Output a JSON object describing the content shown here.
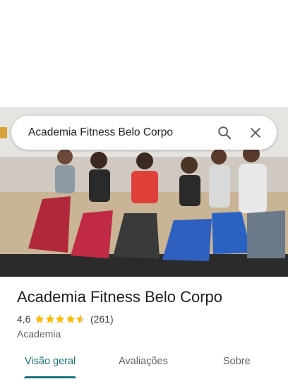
{
  "search": {
    "query": "Academia Fitness Belo Corpo"
  },
  "icons": {
    "search": "search-icon",
    "close": "close-icon",
    "star": "star-icon"
  },
  "place": {
    "name": "Academia Fitness Belo Corpo",
    "rating": "4,6",
    "rating_stars": 4.6,
    "review_count": "(261)",
    "category": "Academia"
  },
  "tabs": [
    {
      "label": "Visão geral",
      "active": true
    },
    {
      "label": "Avaliações",
      "active": false
    },
    {
      "label": "Sobre",
      "active": false
    }
  ],
  "colors": {
    "accent": "#1a7377",
    "star": "#fbbc04",
    "text": "#202124",
    "muted": "#5f6368"
  }
}
